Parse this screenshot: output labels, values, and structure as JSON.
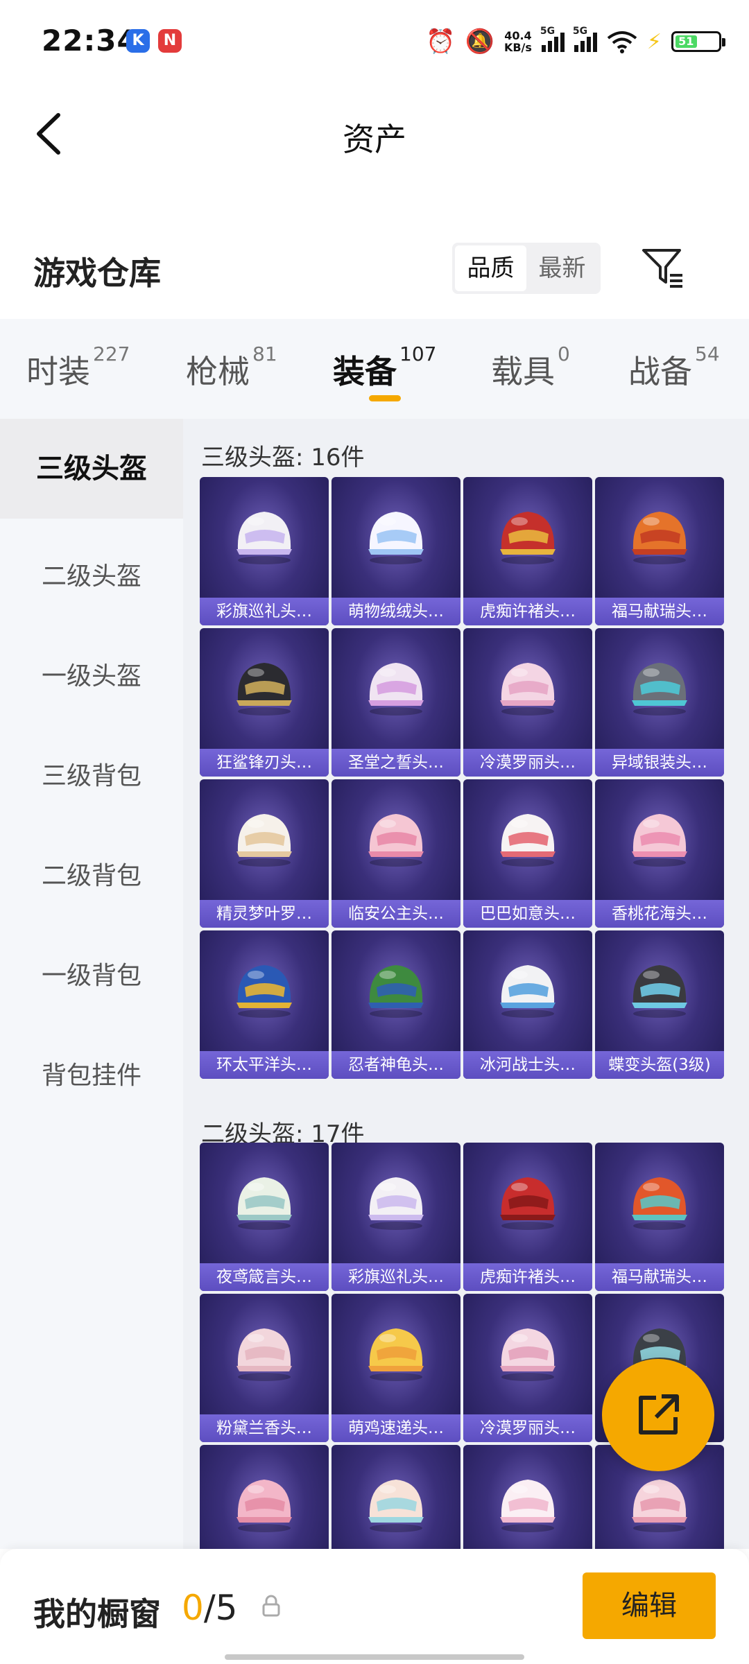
{
  "status_bar": {
    "time": "22:34",
    "app_icons": [
      "K",
      "N"
    ],
    "net_speed_value": "40.4",
    "net_speed_unit": "KB/s",
    "signal_labels": [
      "5G",
      "5G"
    ],
    "battery": "51",
    "icons": [
      "alarm-icon",
      "mute-bell-icon",
      "wifi-icon",
      "charging-icon"
    ]
  },
  "header": {
    "title": "资产"
  },
  "warehouse": {
    "title": "游戏仓库",
    "sort_options": [
      "品质",
      "最新"
    ],
    "active_sort": "品质"
  },
  "tabs": [
    {
      "label": "时装",
      "count": "227"
    },
    {
      "label": "枪械",
      "count": "81"
    },
    {
      "label": "装备",
      "count": "107",
      "active": true
    },
    {
      "label": "载具",
      "count": "0"
    },
    {
      "label": "战备",
      "count": "54"
    }
  ],
  "sidebar": {
    "items": [
      "三级头盔",
      "二级头盔",
      "一级头盔",
      "三级背包",
      "二级背包",
      "一级背包",
      "背包挂件"
    ],
    "active": "三级头盔"
  },
  "sections": [
    {
      "title": "三级头盔: 16件",
      "items": [
        "彩旗巡礼头…",
        "萌物绒绒头…",
        "虎痴许褚头…",
        "福马献瑞头…",
        "狂鲨锋刃头…",
        "圣堂之誓头…",
        "冷漠罗丽头…",
        "异域银装头…",
        "精灵梦叶罗…",
        "临安公主头…",
        "巴巴如意头…",
        "香桃花海头…",
        "环太平洋头…",
        "忍者神龟头…",
        "冰河战士头…",
        "蝶变头盔(3级)"
      ]
    },
    {
      "title": "二级头盔: 17件",
      "items": [
        "夜鸢箴言头…",
        "彩旗巡礼头…",
        "虎痴许褚头…",
        "福马献瑞头…",
        "粉黛兰香头…",
        "萌鸡速递头…",
        "冷漠罗丽头…",
        "",
        "",
        "",
        "",
        ""
      ]
    }
  ],
  "showcase": {
    "label": "我的橱窗",
    "current": "0",
    "max": "/5"
  },
  "edit_button": {
    "label": "编辑"
  },
  "colors": {
    "accent": "#f5a800",
    "card_bg": "#2b2466",
    "card_label_bg": "#6a5ad0"
  },
  "helmet_colors": [
    [
      "#f2f0f5",
      "#c9b7ef"
    ],
    [
      "#f6f6ff",
      "#9fc7f5"
    ],
    [
      "#c5302b",
      "#e7b43d"
    ],
    [
      "#e5732a",
      "#c43e22"
    ],
    [
      "#2b2b30",
      "#c9a85a"
    ],
    [
      "#f0e4f2",
      "#d69fe0"
    ],
    [
      "#f4d5e4",
      "#e7a6c5"
    ],
    [
      "#6b7079",
      "#4fc7d4"
    ],
    [
      "#f6f1ea",
      "#e5c9a0"
    ],
    [
      "#f5c6d3",
      "#e98aa9"
    ],
    [
      "#f7f3f3",
      "#e46a75"
    ],
    [
      "#f5c8d6",
      "#ec8fb1"
    ],
    [
      "#2a59b5",
      "#e4b335"
    ],
    [
      "#3e8a3f",
      "#2f5fb0"
    ],
    [
      "#f2f2f4",
      "#5aa3df"
    ],
    [
      "#3a3a3f",
      "#6fc9e3"
    ],
    [
      "#eaf1e6",
      "#9cc9c6"
    ],
    [
      "#f3f0f5",
      "#cdbbee"
    ],
    [
      "#c82d2d",
      "#8a1a1a"
    ],
    [
      "#e2572a",
      "#5ec2c0"
    ],
    [
      "#f2d6dc",
      "#e5b7c1"
    ],
    [
      "#f6c94a",
      "#f0a13b"
    ],
    [
      "#f4d7e2",
      "#e4a3bd"
    ],
    [
      "#3b4047",
      "#8fd3dc"
    ],
    [
      "#f3b6c8",
      "#e58ea6"
    ],
    [
      "#f7e2d8",
      "#9fd7e0"
    ],
    [
      "#fbeff4",
      "#f1b9cf"
    ],
    [
      "#f6d4dc",
      "#e89cb0"
    ]
  ]
}
